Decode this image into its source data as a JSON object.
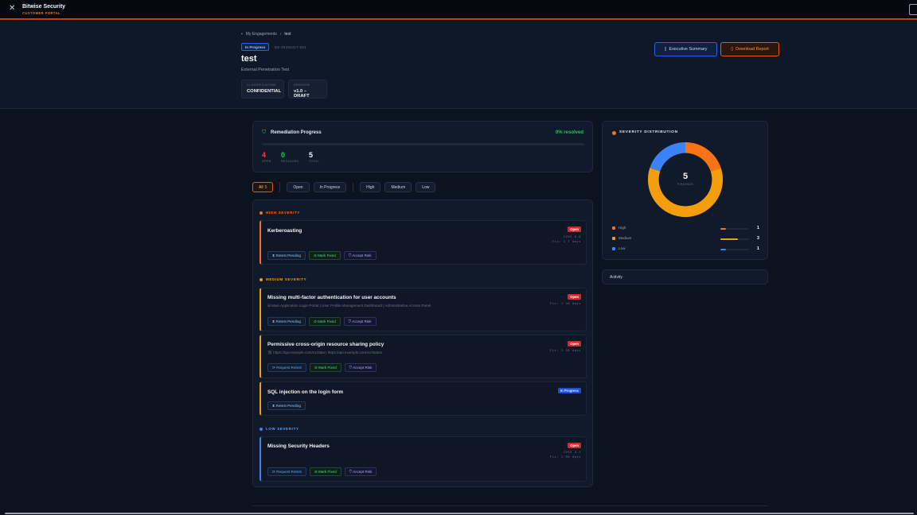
{
  "brand": {
    "name": "Bitwise Security",
    "subtitle": "CUSTOMER PORTAL"
  },
  "breadcrumb": {
    "root": "My Engagements",
    "sep": "›",
    "current": "test"
  },
  "engagement": {
    "status": "In Progress",
    "ref_id": "BS-20260417-001",
    "title": "test",
    "type": "External Penetration Test",
    "classification_label": "CLASSIFICATION",
    "classification_value": "CONFIDENTIAL",
    "version_label": "VERSION",
    "version_value": "v1.0 – DRAFT"
  },
  "actions": {
    "exec_summary": "Executive Summary",
    "download_report": "Download Report"
  },
  "progress": {
    "title": "Remediation Progress",
    "percent_text": "0% resolved",
    "fraction": 0.0,
    "open": "4",
    "open_label": "OPEN",
    "resolved": "0",
    "resolved_label": "RESOLVED",
    "total": "5",
    "total_label": "TOTAL"
  },
  "filters": {
    "all": "All",
    "all_count": "5",
    "open": "Open",
    "in_progress": "In Progress",
    "high": "High",
    "medium": "Medium",
    "low": "Low"
  },
  "sections": {
    "high": "HIGH SEVERITY",
    "medium": "MEDIUM SEVERITY",
    "low": "LOW SEVERITY"
  },
  "findings": [
    {
      "title": "Kerberoasting",
      "status": "Open",
      "cvss": "CVSS 8.0",
      "fix": "Fix: 1 7 days",
      "actions": [
        "Retest Pending",
        "Mark Fixed",
        "Accept Risk"
      ]
    },
    {
      "title": "Missing multi-factor authentication for user accounts",
      "assets": "Main Application Login Portal | User Profile Management Dashboard | Administrative Access Panel",
      "status": "Open",
      "fix": "Fix: 1 30 days",
      "actions": [
        "Retest Pending",
        "Mark Fixed",
        "Accept Risk"
      ]
    },
    {
      "title": "Permissive cross-origin resource sharing policy",
      "assets": "https://api.example.com/v1/data | https://api.example.com/v1/status",
      "status": "Open",
      "fix": "Fix: 1 30 days",
      "actions": [
        "Request Retest",
        "Mark Fixed",
        "Accept Risk"
      ]
    },
    {
      "title": "SQL injection on the login form",
      "status": "In Progress",
      "actions": [
        "Retest Pending"
      ]
    },
    {
      "title": "Missing Security Headers",
      "status": "Open",
      "cvss": "CVSS 4.3",
      "fix": "Fix: 1 90 days",
      "actions": [
        "Request Retest",
        "Mark Fixed",
        "Accept Risk"
      ]
    }
  ],
  "severity_distribution": {
    "title": "SEVERITY DISTRIBUTION",
    "total": "5",
    "total_label": "FINDINGS",
    "items": [
      {
        "name": "High",
        "count": "1",
        "fraction": 0.2,
        "color": "#f97316"
      },
      {
        "name": "Medium",
        "count": "3",
        "fraction": 0.6,
        "color": "#f59e0b"
      },
      {
        "name": "Low",
        "count": "1",
        "fraction": 0.2,
        "color": "#3b82f6"
      }
    ]
  },
  "activity": {
    "title": "Activity"
  },
  "colors": {
    "accent": "#f97316",
    "success": "#22c55e",
    "danger": "#dc2626",
    "info": "#3b82f6"
  }
}
